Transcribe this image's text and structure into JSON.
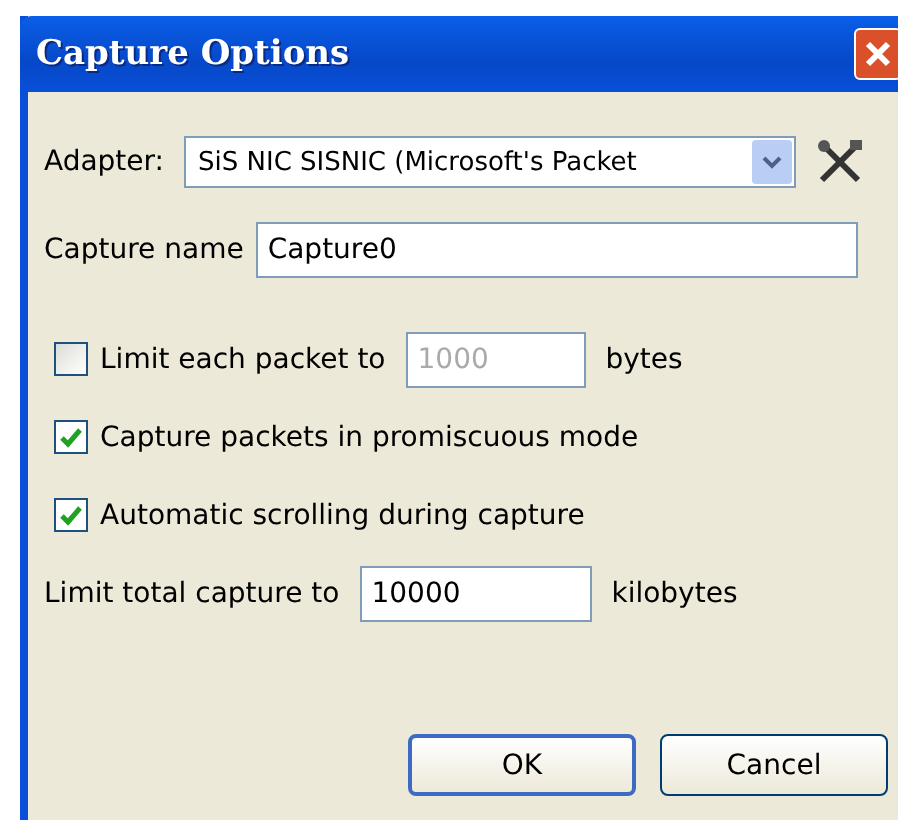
{
  "window": {
    "title": "Capture Options"
  },
  "adapter": {
    "label": "Adapter:",
    "value": "SiS NIC SISNIC (Microsoft's Packet"
  },
  "capture_name": {
    "label": "Capture name",
    "value": "Capture0"
  },
  "options": [
    {
      "kind": "checkbox_field",
      "label": "Limit each packet to",
      "checked": false,
      "value": "1000",
      "disabled": true,
      "unit": "bytes"
    },
    {
      "kind": "checkbox",
      "label": "Capture packets in promiscuous mode",
      "checked": true
    },
    {
      "kind": "checkbox",
      "label": "Automatic scrolling during capture",
      "checked": true
    },
    {
      "kind": "field",
      "label": "Limit total capture to",
      "value": "10000",
      "disabled": false,
      "unit": "kilobytes"
    }
  ],
  "buttons": [
    {
      "label": "OK",
      "default": true
    },
    {
      "label": "Cancel",
      "default": false
    }
  ]
}
